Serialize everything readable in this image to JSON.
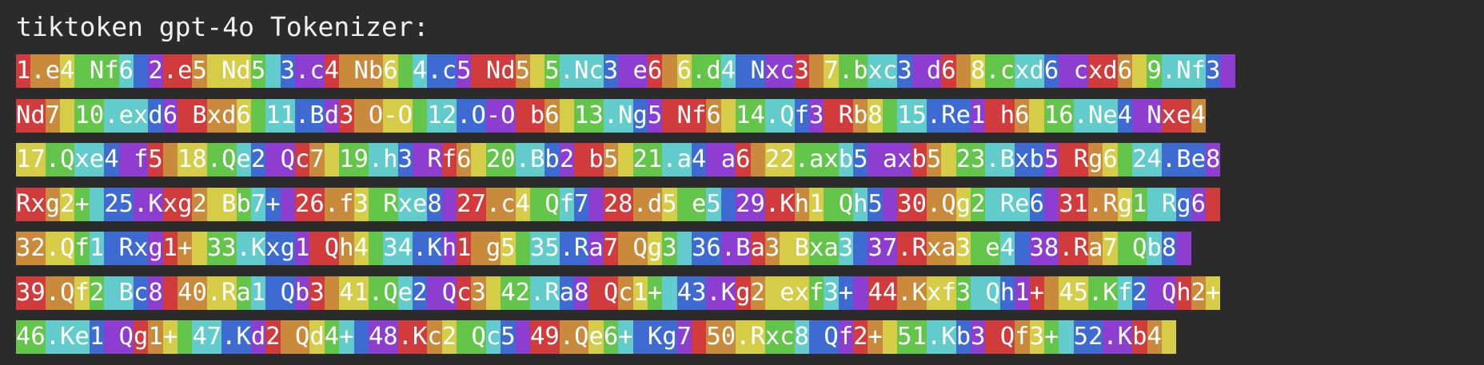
{
  "title": "tiktoken gpt-4o Tokenizer:",
  "palette": [
    "#d13b3b",
    "#c98a3c",
    "#d5cc47",
    "#63c549",
    "#62cbcb",
    "#3e6bd2",
    "#8d3dd0"
  ],
  "lines": [
    [
      "1",
      ".e",
      "4",
      " Nf",
      "6",
      " ",
      "2",
      ".e",
      "5",
      " Nd",
      "5",
      " ",
      "3",
      ".c",
      "4",
      " Nb",
      "6",
      " ",
      "4",
      ".c",
      "5",
      " Nd",
      "5",
      " ",
      "5",
      ".Nc",
      "3",
      " e",
      "6",
      " ",
      "6",
      ".d",
      "4",
      " N",
      "xc",
      "3",
      " ",
      "7",
      ".b",
      "xc",
      "3",
      " d",
      "6",
      " ",
      "8",
      ".c",
      "xd",
      "6",
      " c",
      "xd",
      "6",
      " ",
      "9",
      ".Nf",
      "3",
      " "
    ],
    [
      "Nd",
      "7",
      " ",
      "10",
      ".ex",
      "d",
      "6",
      " B",
      "xd",
      "6",
      " ",
      "11",
      ".B",
      "d",
      "3",
      " O",
      "-O",
      " ",
      "12",
      ".O",
      "-O",
      " b",
      "6",
      " ",
      "13",
      ".N",
      "g",
      "5",
      " Nf",
      "6",
      " ",
      "14",
      ".Q",
      "f",
      "3",
      " R",
      "b",
      "8",
      " ",
      "15",
      ".Re",
      "1",
      " h",
      "6",
      " ",
      "16",
      ".Ne",
      "4",
      " N",
      "xe",
      "4"
    ],
    [
      "17",
      ".Q",
      "xe",
      "4",
      " f",
      "5",
      " ",
      "18",
      ".Q",
      "e",
      "2",
      " Q",
      "c",
      "7",
      " ",
      "19",
      ".h",
      "3",
      " R",
      "f",
      "6",
      " ",
      "20",
      ".B",
      "b",
      "2",
      " b",
      "5",
      " ",
      "21",
      ".a",
      "4",
      " a",
      "6",
      " ",
      "22",
      ".ax",
      "b",
      "5",
      " ax",
      "b",
      "5",
      " ",
      "23",
      ".B",
      "xb",
      "5",
      " R",
      "g",
      "6",
      " ",
      "24",
      ".Be",
      "8"
    ],
    [
      "Rx",
      "g",
      "2",
      "+",
      " ",
      "25",
      ".K",
      "xg",
      "2",
      " B",
      "b",
      "7",
      "+",
      " ",
      "26",
      ".f",
      "3",
      " R",
      "xe",
      "8",
      " ",
      "27",
      ".c",
      "4",
      " Q",
      "f",
      "7",
      " ",
      "28",
      ".d",
      "5",
      " e",
      "5",
      " ",
      "29",
      ".K",
      "h",
      "1",
      " Q",
      "h",
      "5",
      " ",
      "30",
      ".Q",
      "g",
      "2",
      " Re",
      "6",
      " ",
      "31",
      ".R",
      "g",
      "1",
      " R",
      "g",
      "6",
      " "
    ],
    [
      "32",
      ".Q",
      "f",
      "1",
      " Rx",
      "g",
      "1",
      "+",
      " ",
      "33",
      ".K",
      "xg",
      "1",
      " Q",
      "h",
      "4",
      " ",
      "34",
      ".K",
      "h",
      "1",
      " g",
      "5",
      " ",
      "35",
      ".R",
      "a",
      "7",
      " Q",
      "g",
      "3",
      " ",
      "36",
      ".B",
      "a",
      "3",
      " B",
      "xa",
      "3",
      " ",
      "37",
      ".R",
      "xa",
      "3",
      " e",
      "4",
      " ",
      "38",
      ".R",
      "a",
      "7",
      " Q",
      "b",
      "8",
      " "
    ],
    [
      "39",
      ".Q",
      "f",
      "2",
      " B",
      "c",
      "8",
      " ",
      "40",
      ".R",
      "a",
      "1",
      " Q",
      "b",
      "3",
      " ",
      "41",
      ".Q",
      "e",
      "2",
      " Q",
      "c",
      "3",
      " ",
      "42",
      ".R",
      "a",
      "8",
      " Q",
      "c",
      "1",
      "+",
      " ",
      "43",
      ".K",
      "g",
      "2",
      " ex",
      "f",
      "3",
      "+",
      " ",
      "44",
      ".K",
      "xf",
      "3",
      " Q",
      "h",
      "1",
      "+",
      " ",
      "45",
      ".K",
      "f",
      "2",
      " Q",
      "h",
      "2",
      "+"
    ],
    [
      "46",
      ".Ke",
      "1",
      " Q",
      "g",
      "1",
      "+",
      " ",
      "47",
      ".K",
      "d",
      "2",
      " Q",
      "d",
      "4",
      "+",
      " ",
      "48",
      ".K",
      "c",
      "2",
      " Q",
      "c",
      "5",
      " ",
      "49",
      ".Q",
      "e",
      "6",
      "+",
      " Kg",
      "7",
      " ",
      "50",
      ".R",
      "xc",
      "8",
      " Q",
      "f",
      "2",
      "+",
      " ",
      "51",
      ".K",
      "b",
      "3",
      " Q",
      "f",
      "3",
      "+",
      " ",
      "52",
      ".K",
      "b",
      "4",
      " "
    ]
  ]
}
